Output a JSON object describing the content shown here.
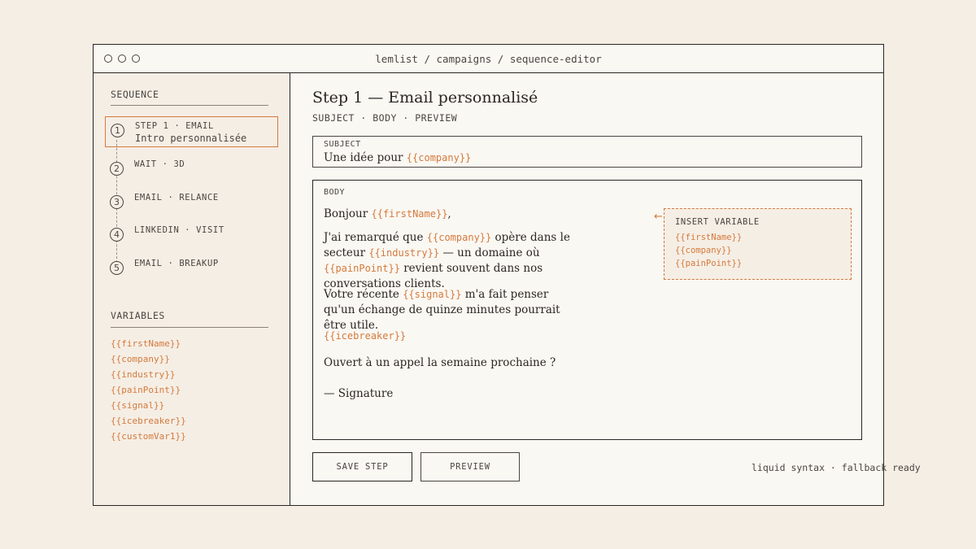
{
  "window": {
    "title": "lemlist / campaigns / sequence-editor"
  },
  "sidebar": {
    "sequence_heading": "SEQUENCE",
    "steps": [
      {
        "num": "1",
        "title": "STEP 1 · EMAIL",
        "subtitle": "Intro personnalisée",
        "active": true
      },
      {
        "num": "2",
        "title": "WAIT · 3D"
      },
      {
        "num": "3",
        "title": "EMAIL · RELANCE"
      },
      {
        "num": "4",
        "title": "LINKEDIN · VISIT"
      },
      {
        "num": "5",
        "title": "EMAIL · BREAKUP"
      }
    ],
    "variables_heading": "VARIABLES",
    "variables": [
      "{{firstName}}",
      "{{company}}",
      "{{industry}}",
      "{{painPoint}}",
      "{{signal}}",
      "{{icebreaker}}",
      "{{customVar1}}"
    ]
  },
  "main": {
    "title": "Step 1 — Email personnalisé",
    "tabs": "SUBJECT · BODY · PREVIEW",
    "subject": {
      "label": "SUBJECT",
      "text": "Une idée pour ",
      "var": "{{company}}"
    },
    "body": {
      "label": "BODY",
      "greeting": {
        "text": "Bonjour ",
        "var": "{{firstName}}",
        "suffix": ","
      },
      "p1": {
        "a": "J'ai remarqué que ",
        "var1": "{{company}}",
        "b": " opère dans le secteur ",
        "var2": "{{industry}}",
        "c": " — un domaine où ",
        "var3": "{{painPoint}}",
        "d": " revient souvent dans nos conversations clients."
      },
      "p2": {
        "a": "Votre récente ",
        "var": "{{signal}}",
        "b": " m'a fait penser qu'un échange de quinze minutes pourrait être utile."
      },
      "icebreaker": "{{icebreaker}}",
      "p3": "Ouvert à un appel la semaine prochaine ?",
      "signature": "— Signature"
    },
    "insert_panel": {
      "arrow": "←",
      "title": "INSERT VARIABLE",
      "items": [
        "{{firstName}}",
        "{{company}}",
        "{{painPoint}}"
      ]
    },
    "buttons": {
      "save": "SAVE STEP",
      "preview": "PREVIEW"
    },
    "footnote": "liquid syntax · fallback ready"
  },
  "colors": {
    "accent": "#d47a3c",
    "ink": "#2a2622",
    "background": "#f5eee5",
    "panel": "#faf8f3"
  }
}
